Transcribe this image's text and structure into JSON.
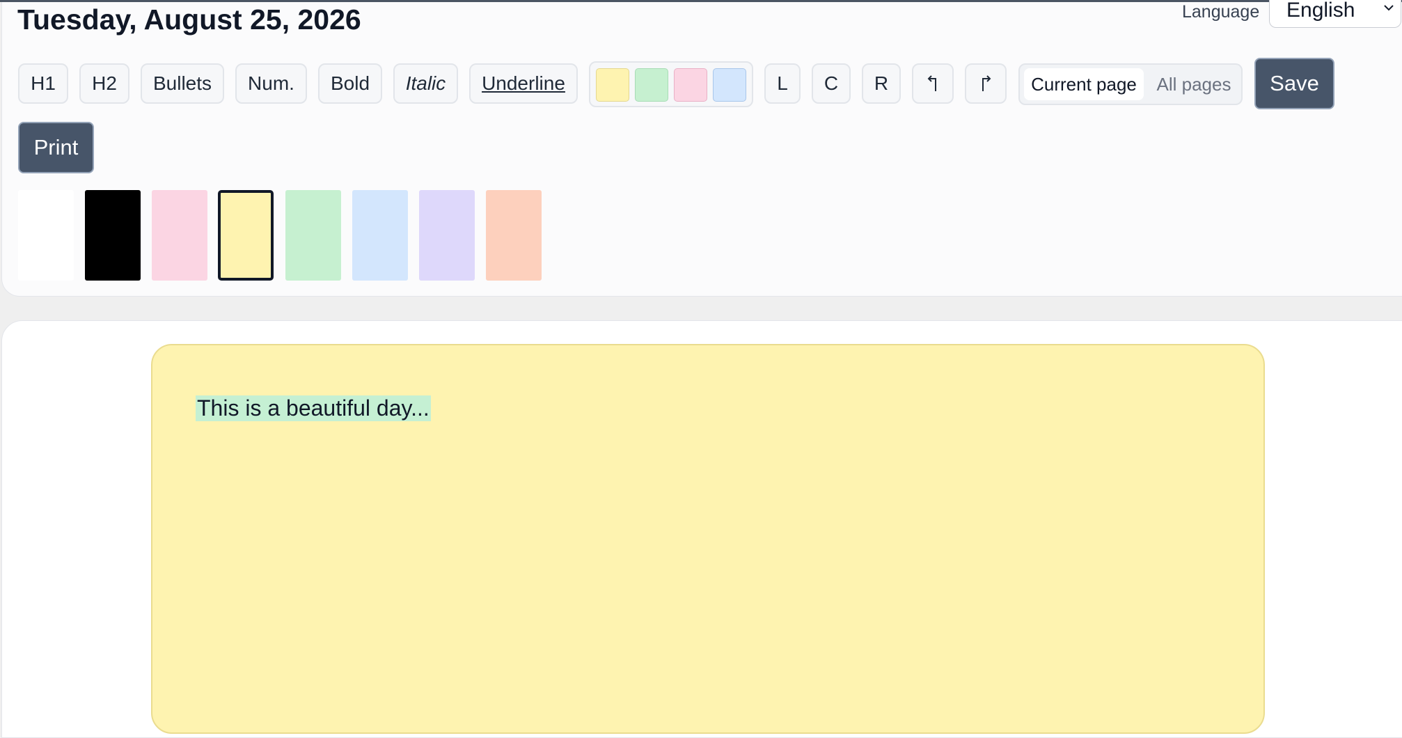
{
  "header": {
    "date": "Tuesday, August 25, 2026",
    "language_label": "Language",
    "language_value": "English"
  },
  "toolbar": {
    "h1": "H1",
    "h2": "H2",
    "bullets": "Bullets",
    "numbered": "Num.",
    "bold": "Bold",
    "italic": "Italic",
    "underline": "Underline",
    "highlight_colors": [
      "#fef3b0",
      "#c6f0d0",
      "#fbd5e3",
      "#d3e6fd"
    ],
    "align_left": "L",
    "align_center": "C",
    "align_right": "R",
    "undo_icon": "undo-icon",
    "redo_icon": "redo-icon",
    "scope_current": "Current page",
    "scope_all": "All pages",
    "save": "Save",
    "print": "Print"
  },
  "page_colors": {
    "options": [
      "#ffffff",
      "#000000",
      "#fbd5e3",
      "#fef3b0",
      "#c6f0d0",
      "#d3e6fd",
      "#ded8fb",
      "#fdd0bd"
    ],
    "selected": "#fef3b0"
  },
  "editor": {
    "text": "This is a beautiful day...",
    "page_color": "#fef3b0",
    "highlight_color": "#c5f0d3"
  }
}
